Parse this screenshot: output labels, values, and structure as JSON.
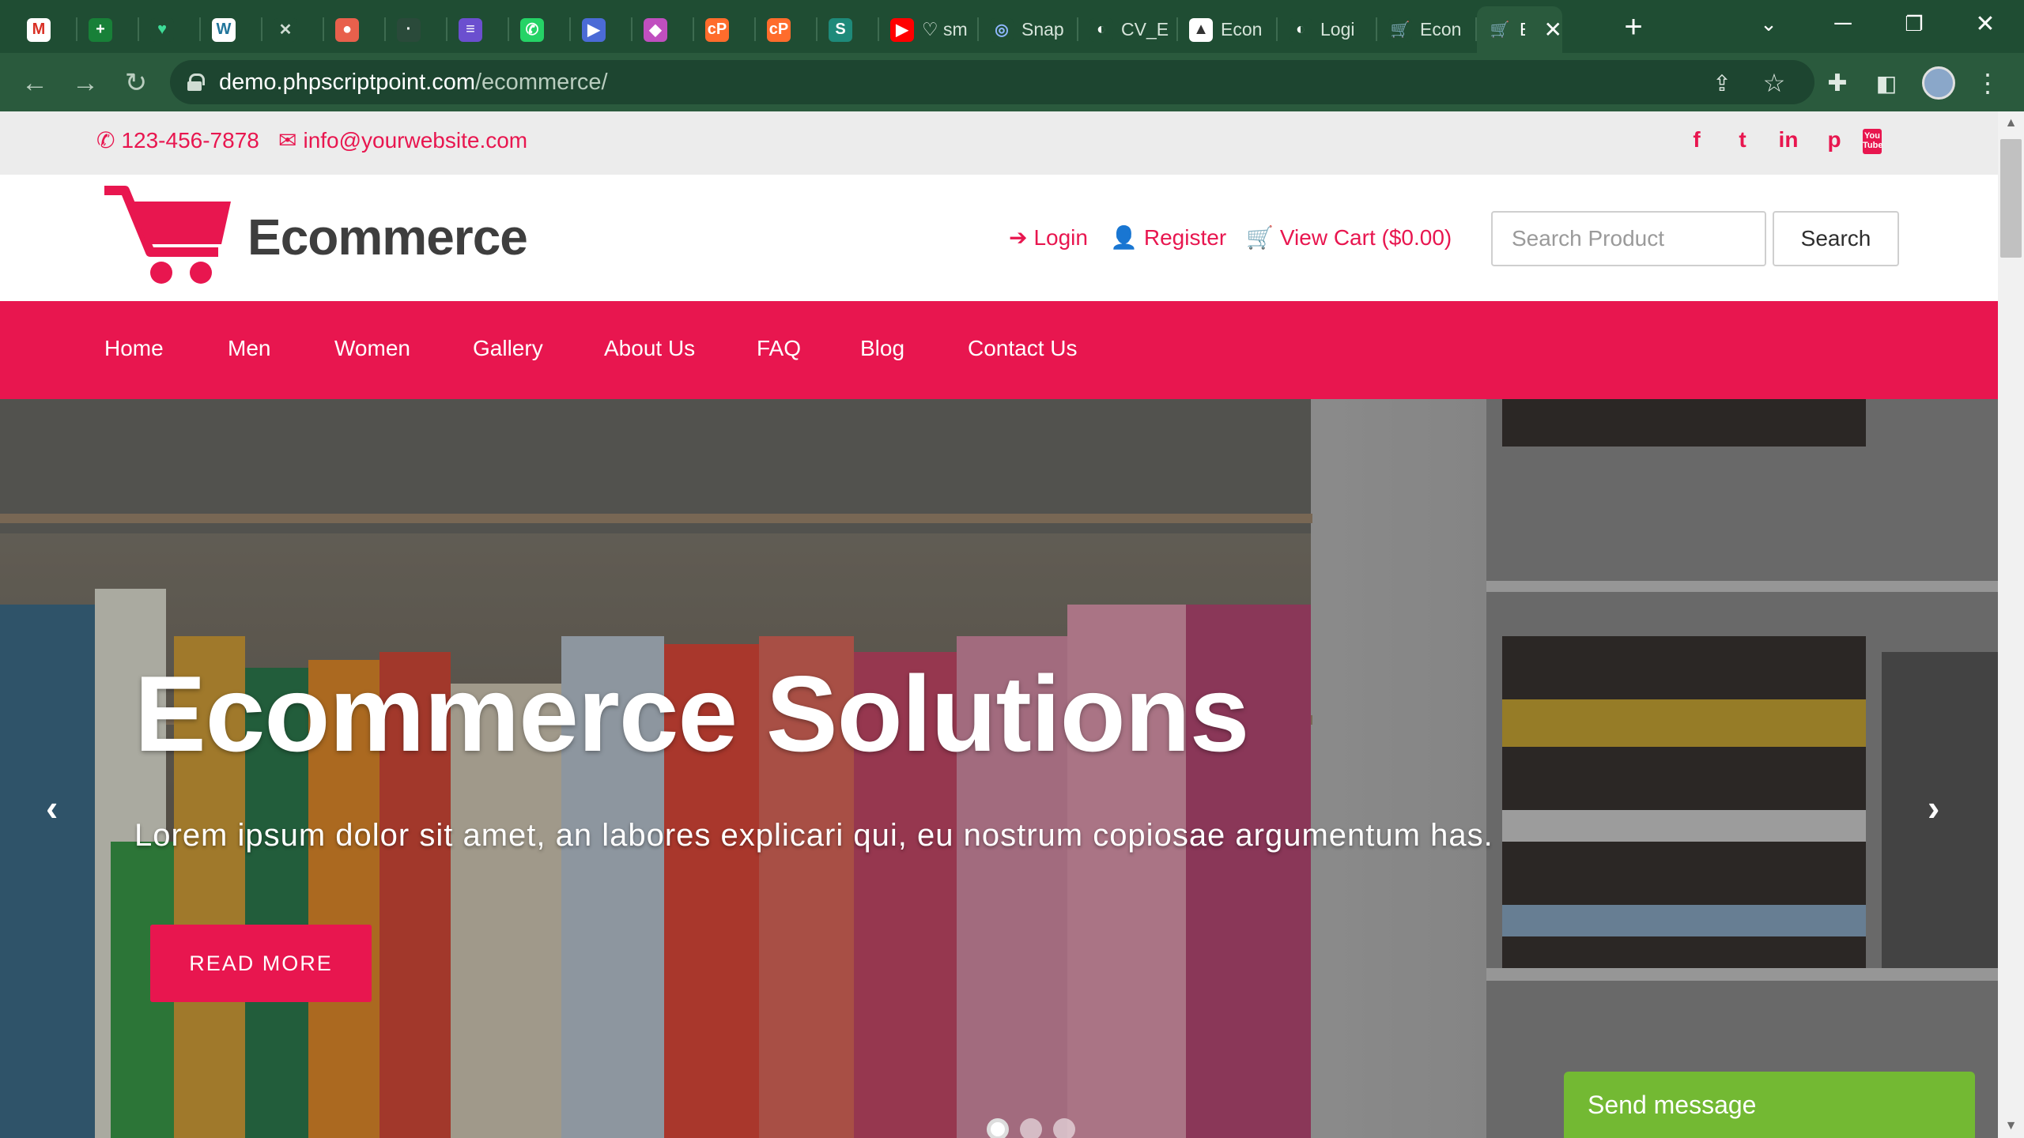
{
  "browser": {
    "tabs": [
      {
        "label": "",
        "fav_color": "#ffffff",
        "fav_glyph": "M",
        "fav_text_color": "#d93025"
      },
      {
        "label": "",
        "fav_color": "#188038",
        "fav_glyph": "+"
      },
      {
        "label": "",
        "fav_color": "#1f4d33",
        "fav_glyph": "♥",
        "fav_text_color": "#3ddc97"
      },
      {
        "label": "",
        "fav_color": "#ffffff",
        "fav_glyph": "W",
        "fav_text_color": "#21759b"
      },
      {
        "label": "",
        "fav_color": "#1f4d33",
        "fav_glyph": "✕",
        "fav_text_color": "#cfdcd3"
      },
      {
        "label": "",
        "fav_color": "#e8604c",
        "fav_glyph": "●"
      },
      {
        "label": "",
        "fav_color": "#2a4a3a",
        "fav_glyph": "·"
      },
      {
        "label": "",
        "fav_color": "#6b4fcf",
        "fav_glyph": "≡"
      },
      {
        "label": "",
        "fav_color": "#25d366",
        "fav_glyph": "✆"
      },
      {
        "label": "",
        "fav_color": "#4b6bd6",
        "fav_glyph": "▶"
      },
      {
        "label": "",
        "fav_color": "#c04fbf",
        "fav_glyph": "◆"
      },
      {
        "label": "",
        "fav_color": "#ff6c2c",
        "fav_glyph": "cP"
      },
      {
        "label": "",
        "fav_color": "#ff6c2c",
        "fav_glyph": "cP"
      },
      {
        "label": "",
        "fav_color": "#1e8a7a",
        "fav_glyph": "S"
      },
      {
        "label": "♡ sm",
        "fav_color": "#ff0000",
        "fav_glyph": "▶"
      },
      {
        "label": "Snap",
        "fav_color": "#1f4d33",
        "fav_glyph": "◎",
        "fav_text_color": "#8fb8ff"
      },
      {
        "label": "CV_E",
        "fav_color": "#1f4d33",
        "fav_glyph": "◐",
        "fav_text_color": "#ffffff"
      },
      {
        "label": "Econ",
        "fav_color": "#ffffff",
        "fav_glyph": "▲",
        "fav_text_color": "#333333"
      },
      {
        "label": "Logi",
        "fav_color": "#1f4d33",
        "fav_glyph": "◐",
        "fav_text_color": "#ffffff"
      },
      {
        "label": "Econ",
        "fav_color": "#1f4d33",
        "fav_glyph": "🛒",
        "fav_text_color": "#e8164f"
      },
      {
        "label": "E",
        "fav_color": "#2a5a3d",
        "fav_glyph": "🛒",
        "fav_text_color": "#e8164f",
        "active": true
      }
    ],
    "url_host": "demo.phpscriptpoint.com",
    "url_path": "/ecommerce/"
  },
  "topbar": {
    "phone": "123-456-7878",
    "email": "info@yourwebsite.com",
    "social": [
      "f",
      "t",
      "in",
      "p",
      "You Tube"
    ]
  },
  "header": {
    "logo_text": "Ecommerce",
    "login": "Login",
    "register": "Register",
    "cart": "View Cart ($0.00)",
    "search_placeholder": "Search Product",
    "search_button": "Search"
  },
  "nav": {
    "items": [
      "Home",
      "Men",
      "Women",
      "Gallery",
      "About Us",
      "FAQ",
      "Blog",
      "Contact Us"
    ]
  },
  "hero": {
    "title": "Ecommerce Solutions",
    "subtitle": "Lorem ipsum dolor sit amet, an labores explicari qui, eu nostrum copiosae argumentum has.",
    "button": "READ MORE",
    "slides": 3,
    "active_slide": 1
  },
  "chat": {
    "label": "Send message"
  },
  "colors": {
    "brand": "#e8164f",
    "chat": "#73b933",
    "chrome": "#1f4d33"
  }
}
